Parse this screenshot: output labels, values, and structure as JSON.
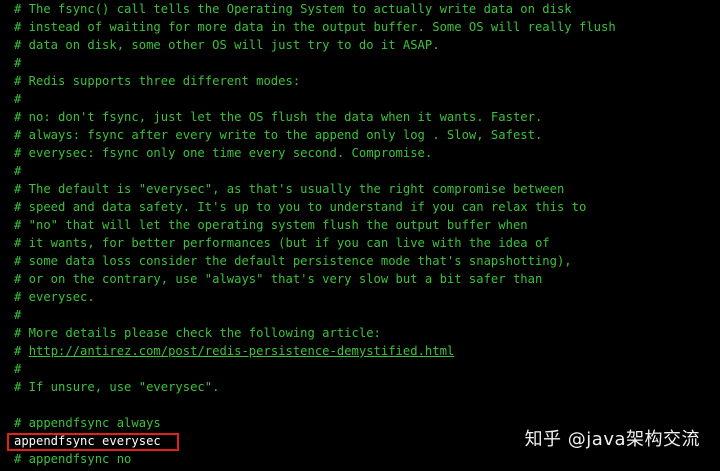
{
  "config_file": {
    "lines": [
      "# The fsync() call tells the Operating System to actually write data on disk",
      "# instead of waiting for more data in the output buffer. Some OS will really flush",
      "# data on disk, some other OS will just try to do it ASAP.",
      "#",
      "# Redis supports three different modes:",
      "#",
      "# no: don't fsync, just let the OS flush the data when it wants. Faster.",
      "# always: fsync after every write to the append only log . Slow, Safest.",
      "# everysec: fsync only one time every second. Compromise.",
      "#",
      "# The default is \"everysec\", as that's usually the right compromise between",
      "# speed and data safety. It's up to you to understand if you can relax this to",
      "# \"no\" that will let the operating system flush the output buffer when",
      "# it wants, for better performances (but if you can live with the idea of",
      "# some data loss consider the default persistence mode that's snapshotting),",
      "# or on the contrary, use \"always\" that's very slow but a bit safer than",
      "# everysec.",
      "#",
      "# More details please check the following article:",
      "# ",
      "#",
      "# If unsure, use \"everysec\".",
      "",
      "# appendfsync always",
      "appendfsync everysec",
      "# appendfsync no"
    ],
    "article_url": "http://antirez.com/post/redis-persistence-demystified.html"
  },
  "colors": {
    "background": "#000000",
    "comment_text": "#3cc13c",
    "active_text": "#ffffff",
    "highlight_border": "#e0221e"
  },
  "watermark": {
    "text": "知乎 @java架构交流"
  }
}
